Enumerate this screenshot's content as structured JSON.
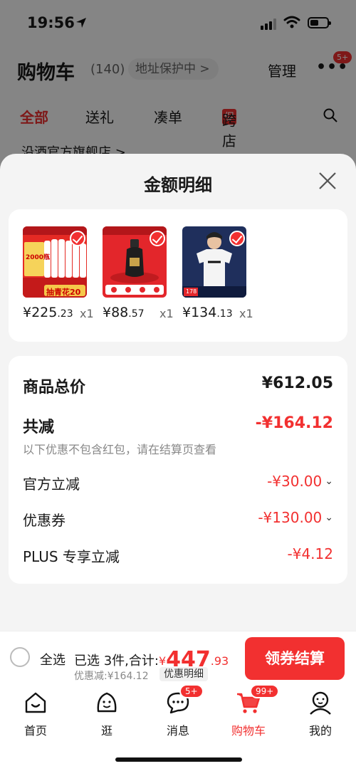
{
  "status_bar": {
    "time": "19:56"
  },
  "cart_header": {
    "title": "购物车",
    "count": "(140)",
    "address_pill": "地址保护中 >",
    "manage": "管理",
    "more": "•••",
    "more_badge": "5+"
  },
  "tabs": [
    {
      "label": "全部"
    },
    {
      "label": "送礼"
    },
    {
      "label": "凑单"
    },
    {
      "label": "跨店满",
      "badge": "促"
    }
  ],
  "store_partial": "沿酒官方旗舰店 >",
  "sheet": {
    "title": "金额明细",
    "items": [
      {
        "price_int": "¥225",
        "price_dec": ".23",
        "qty": "x1",
        "thumb_text": "抽青花20",
        "thumb_badge": "2000瓶"
      },
      {
        "price_int": "¥88",
        "price_dec": ".57",
        "qty": "x1"
      },
      {
        "price_int": "¥134",
        "price_dec": ".13",
        "qty": "x1",
        "thumb_text": "178"
      }
    ],
    "summary": {
      "total_label": "商品总价",
      "total_value": "¥612.05",
      "reduce_label": "共减",
      "reduce_value": "-¥164.12",
      "note": "以下优惠不包含红包，请在结算页查看",
      "official_label": "官方立减",
      "official_value": "-¥30.00",
      "coupon_label": "优惠券",
      "coupon_value": "-¥130.00",
      "plus_label": "PLUS 专享立减",
      "plus_value": "-¥4.12"
    }
  },
  "checkout": {
    "select_all": "全选",
    "selected_text": "已选 3件,合计:",
    "currency": "¥",
    "amount_int": "447",
    "amount_dec": ".93",
    "discount_line": "优惠减:¥164.12",
    "detail_link": "优惠明细",
    "pay_button": "领券结算"
  },
  "nav": [
    {
      "label": "首页"
    },
    {
      "label": "逛"
    },
    {
      "label": "消息",
      "badge": "5+"
    },
    {
      "label": "购物车",
      "badge": "99+"
    },
    {
      "label": "我的"
    }
  ],
  "colors": {
    "accent": "#f23030"
  }
}
